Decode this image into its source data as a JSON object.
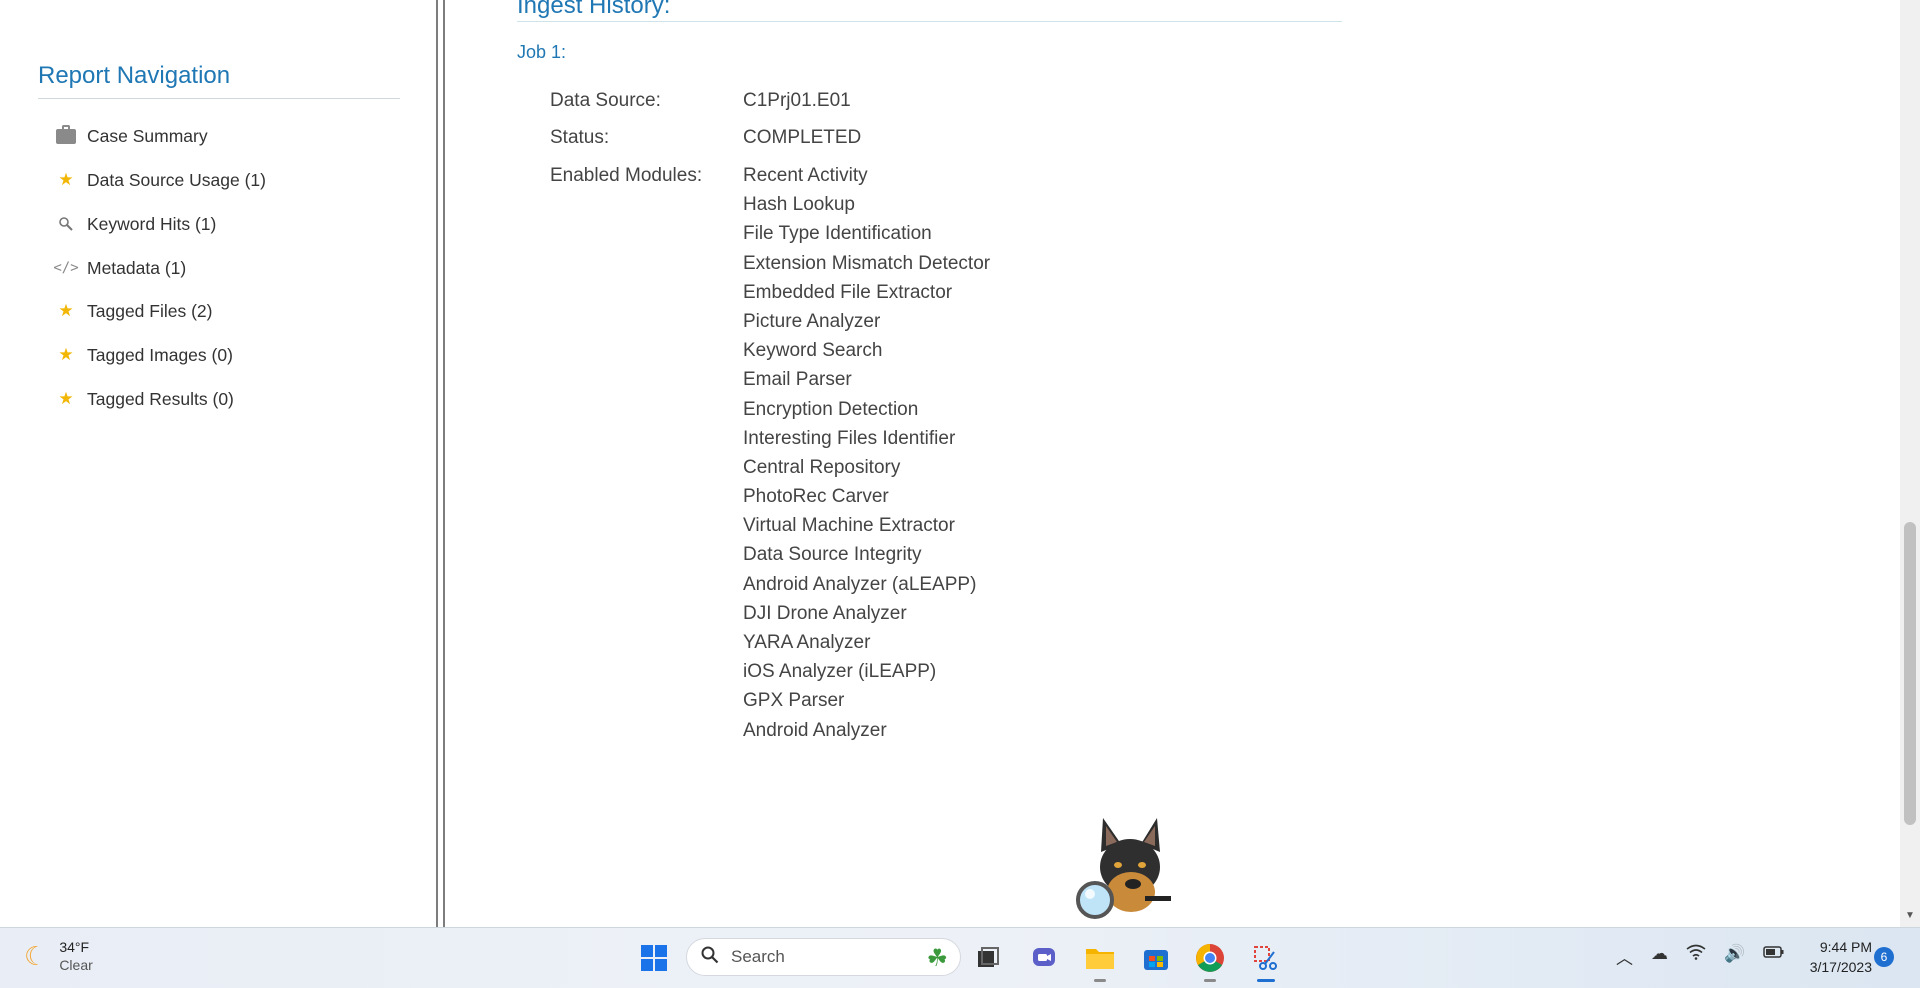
{
  "nav": {
    "title": "Report Navigation",
    "items": [
      {
        "label": "Case Summary",
        "icon": "briefcase-icon"
      },
      {
        "label": "Data Source Usage (1)",
        "icon": "star-icon"
      },
      {
        "label": "Keyword Hits (1)",
        "icon": "magnifier-icon"
      },
      {
        "label": "Metadata (1)",
        "icon": "code-icon"
      },
      {
        "label": "Tagged Files (2)",
        "icon": "star-icon"
      },
      {
        "label": "Tagged Images (0)",
        "icon": "star-icon"
      },
      {
        "label": "Tagged Results (0)",
        "icon": "star-icon"
      }
    ]
  },
  "main": {
    "section_title": "Ingest History:",
    "job_title": "Job 1:",
    "data_source_label": "Data Source:",
    "data_source_value": "C1Prj01.E01",
    "status_label": "Status:",
    "status_value": "COMPLETED",
    "modules_label": "Enabled Modules:",
    "modules": [
      "Recent Activity",
      "Hash Lookup",
      "File Type Identification",
      "Extension Mismatch Detector",
      "Embedded File Extractor",
      "Picture Analyzer",
      "Keyword Search",
      "Email Parser",
      "Encryption Detection",
      "Interesting Files Identifier",
      "Central Repository",
      "PhotoRec Carver",
      "Virtual Machine Extractor",
      "Data Source Integrity",
      "Android Analyzer (aLEAPP)",
      "DJI Drone Analyzer",
      "YARA Analyzer",
      "iOS Analyzer (iLEAPP)",
      "GPX Parser",
      "Android Analyzer"
    ]
  },
  "taskbar": {
    "weather_temp": "34°F",
    "weather_desc": "Clear",
    "search_label": "Search",
    "time": "9:44 PM",
    "date": "3/17/2023",
    "notification_count": "6"
  },
  "colors": {
    "accent": "#1f77b4",
    "star": "#f2b705",
    "taskbar_active": "#1f6fd1"
  }
}
